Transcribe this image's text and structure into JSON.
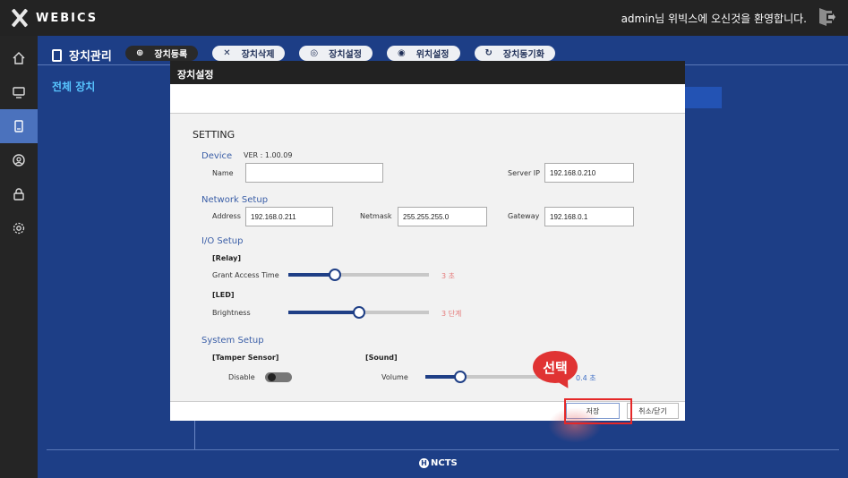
{
  "topbar": {
    "logo_text": "WEBICS",
    "welcome": "admin님 위빅스에 오신것을 환영합니다."
  },
  "sidebar": {
    "items": [
      {
        "icon": "home-icon"
      },
      {
        "icon": "monitor-icon"
      },
      {
        "icon": "device-icon",
        "active": true
      },
      {
        "icon": "user-icon"
      },
      {
        "icon": "lock-icon"
      },
      {
        "icon": "gear-icon"
      }
    ]
  },
  "main": {
    "title": "장치관리",
    "tree_label": "전체 장치",
    "toolbar": [
      {
        "label": "장치등록",
        "icon": "⊕"
      },
      {
        "label": "장치삭제",
        "icon": "✕"
      },
      {
        "label": "장치설정",
        "icon": "◎"
      },
      {
        "label": "위치설정",
        "icon": "◉"
      },
      {
        "label": "장치동기화",
        "icon": "↻"
      }
    ],
    "footer_logo": "NCTS",
    "footer_logo_badge": "H"
  },
  "modal": {
    "title": "장치설정",
    "setting_title": "SETTING",
    "device": {
      "section": "Device",
      "version": "VER : 1.00.09",
      "name_label": "Name",
      "name_value": "",
      "server_ip_label": "Server IP",
      "server_ip_value": "192.168.0.210"
    },
    "network": {
      "section": "Network Setup",
      "address_label": "Address",
      "address_value": "192.168.0.211",
      "netmask_label": "Netmask",
      "netmask_value": "255.255.255.0",
      "gateway_label": "Gateway",
      "gateway_value": "192.168.0.1"
    },
    "io": {
      "section": "I/O Setup",
      "relay_label": "[Relay]",
      "grant_label": "Grant Access Time",
      "grant_value": "3 초",
      "grant_level": 0.33,
      "led_label": "[LED]",
      "brightness_label": "Brightness",
      "brightness_value": "3 단계",
      "brightness_level": 0.5
    },
    "system": {
      "section": "System Setup",
      "tamper_label": "[Tamper Sensor]",
      "disable_label": "Disable",
      "tamper_enabled": false,
      "sound_label": "[Sound]",
      "volume_label": "Volume",
      "volume_value": "0.4 초",
      "volume_level": 0.26
    },
    "save_label": "저장",
    "close_label": "취소/닫기"
  },
  "annotation": {
    "callout": "선택",
    "color": "#e03333"
  },
  "colors": {
    "topbar": "#232323",
    "main_bg": "#1d3e86",
    "sidebar_active": "#4b72bd",
    "slider_fill": "#1f3f86"
  }
}
